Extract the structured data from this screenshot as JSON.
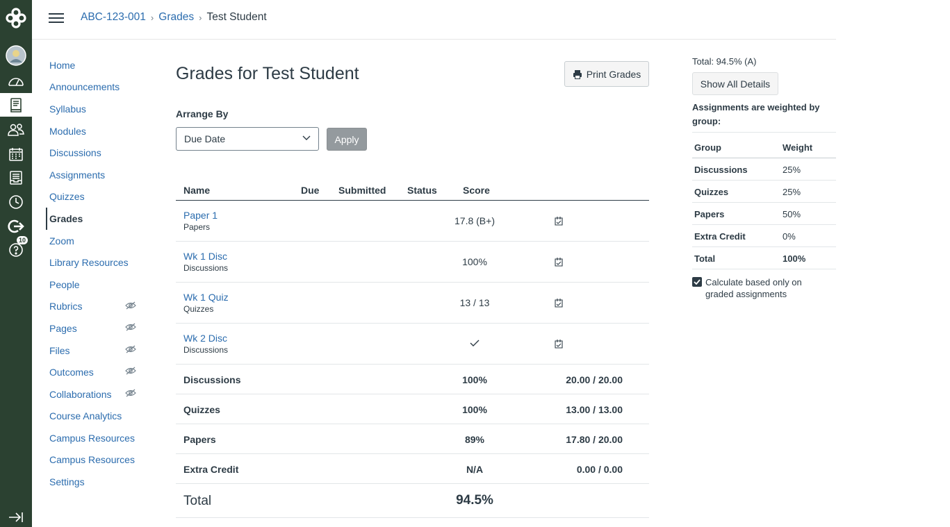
{
  "global_nav": {
    "badge_count": "10",
    "bg_color": "#2b4131"
  },
  "header": {
    "breadcrumbs": [
      "ABC-123-001",
      "Grades",
      "Test Student"
    ]
  },
  "course_nav": {
    "items": [
      {
        "label": "Home"
      },
      {
        "label": "Announcements"
      },
      {
        "label": "Syllabus"
      },
      {
        "label": "Modules"
      },
      {
        "label": "Discussions"
      },
      {
        "label": "Assignments"
      },
      {
        "label": "Quizzes"
      },
      {
        "label": "Grades",
        "active": true
      },
      {
        "label": "Zoom"
      },
      {
        "label": "Library Resources"
      },
      {
        "label": "People"
      },
      {
        "label": "Rubrics",
        "hidden": true
      },
      {
        "label": "Pages",
        "hidden": true
      },
      {
        "label": "Files",
        "hidden": true
      },
      {
        "label": "Outcomes",
        "hidden": true
      },
      {
        "label": "Collaborations",
        "hidden": true
      },
      {
        "label": "Course Analytics"
      },
      {
        "label": "Campus Resources"
      },
      {
        "label": "Campus Resources"
      },
      {
        "label": "Settings"
      }
    ]
  },
  "main": {
    "title": "Grades for Test Student",
    "print_label": "Print Grades",
    "arrange_label": "Arrange By",
    "arrange_value": "Due Date",
    "apply_label": "Apply",
    "columns": {
      "name": "Name",
      "due": "Due",
      "submitted": "Submitted",
      "status": "Status",
      "score": "Score"
    },
    "assignments": [
      {
        "name": "Paper 1",
        "group": "Papers",
        "score": "17.8 (B+)"
      },
      {
        "name": "Wk 1 Disc",
        "group": "Discussions",
        "score": "100%"
      },
      {
        "name": "Wk 1 Quiz",
        "group": "Quizzes",
        "score": "13 / 13"
      },
      {
        "name": "Wk 2 Disc",
        "group": "Discussions",
        "score": "",
        "score_icon": "checkmark-icon"
      }
    ],
    "groups": [
      {
        "name": "Discussions",
        "percent": "100%",
        "points": "20.00 / 20.00"
      },
      {
        "name": "Quizzes",
        "percent": "100%",
        "points": "13.00 / 13.00"
      },
      {
        "name": "Papers",
        "percent": "89%",
        "points": "17.80 / 20.00"
      },
      {
        "name": "Extra Credit",
        "percent": "N/A",
        "points": "0.00 / 0.00"
      }
    ],
    "total": {
      "label": "Total",
      "percent": "94.5%"
    }
  },
  "sidebar_right": {
    "total_text": "Total: 94.5% (A)",
    "show_details_label": "Show All Details",
    "weighted_note": "Assignments are weighted by group:",
    "weight_headers": {
      "group": "Group",
      "weight": "Weight"
    },
    "weights": [
      {
        "group": "Discussions",
        "weight": "25%"
      },
      {
        "group": "Quizzes",
        "weight": "25%"
      },
      {
        "group": "Papers",
        "weight": "50%"
      },
      {
        "group": "Extra Credit",
        "weight": "0%"
      },
      {
        "group": "Total",
        "weight": "100%",
        "bold": true
      }
    ],
    "calculate_label": "Calculate based only on graded assignments",
    "calculate_checked": true
  }
}
